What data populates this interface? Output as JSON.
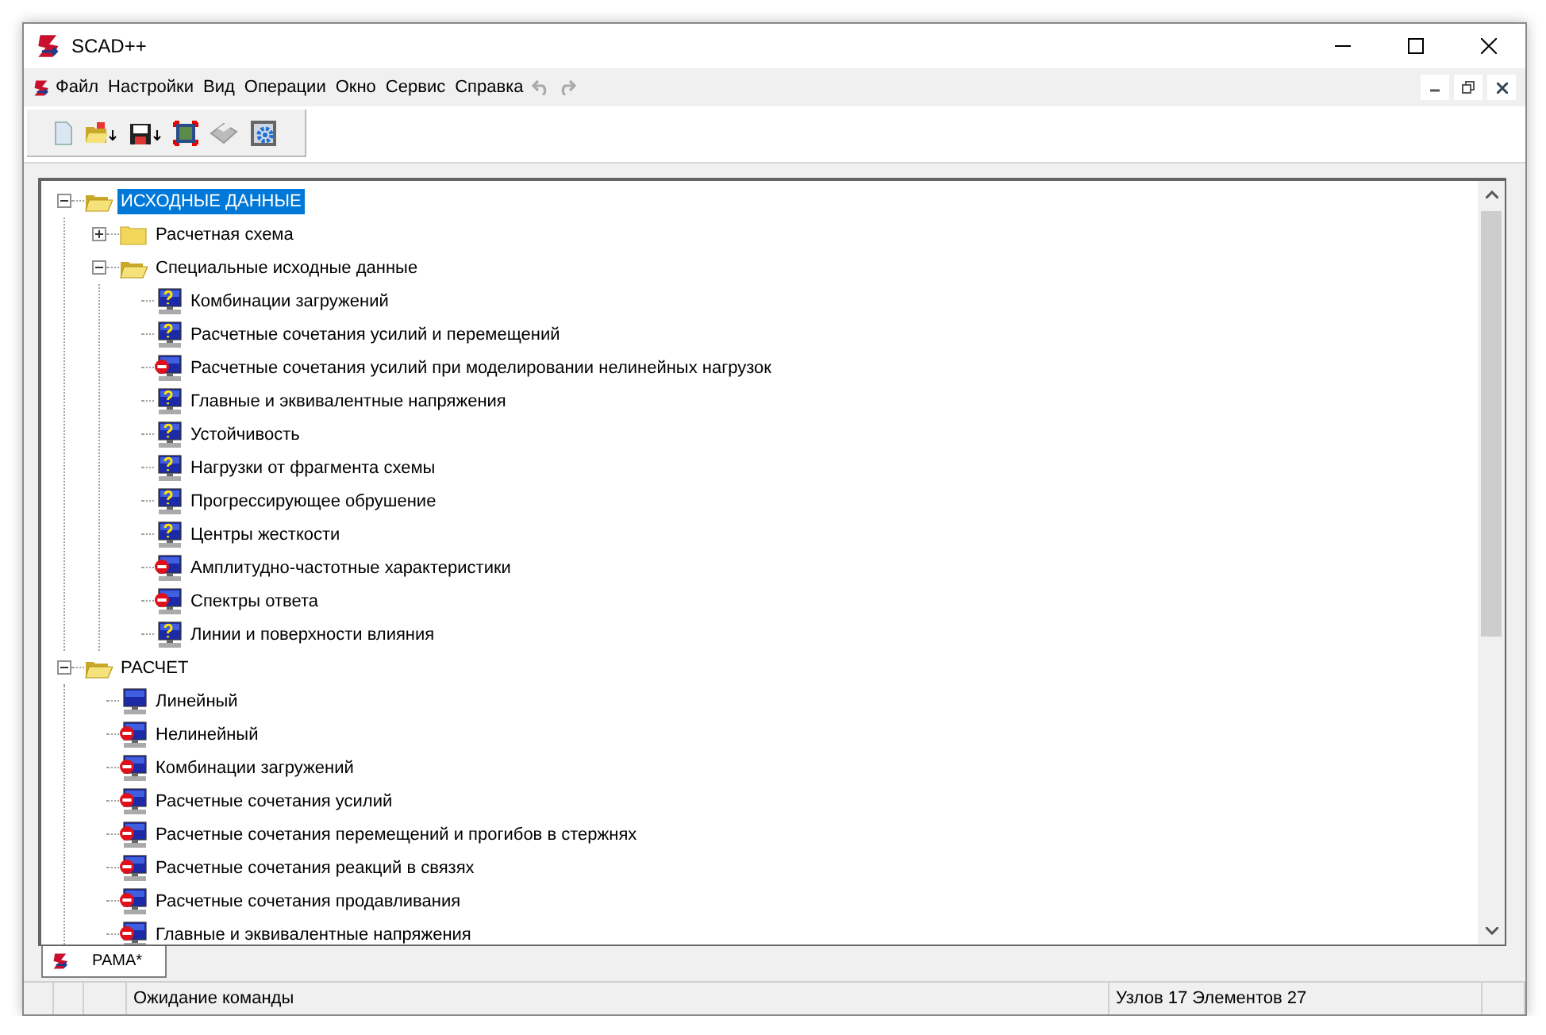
{
  "window": {
    "title": "SCAD++"
  },
  "menu": [
    "Файл",
    "Настройки",
    "Вид",
    "Операции",
    "Окно",
    "Сервис",
    "Справка"
  ],
  "tree": [
    {
      "label": "ИСХОДНЫЕ ДАННЫЕ",
      "kind": "folder",
      "expanded": true,
      "selected": true,
      "children": [
        {
          "label": "Расчетная схема",
          "kind": "folder",
          "expanded": false,
          "selected": false
        },
        {
          "label": "Специальные исходные данные",
          "kind": "folder",
          "expanded": true,
          "selected": false,
          "children": [
            {
              "label": "Комбинации загружений",
              "kind": "question",
              "selected": false
            },
            {
              "label": "Расчетные сочетания усилий и перемещений",
              "kind": "question",
              "selected": false
            },
            {
              "label": "Расчетные сочетания усилий при моделировании нелинейных нагрузок",
              "kind": "blocked",
              "selected": false
            },
            {
              "label": "Главные и эквивалентные напряжения",
              "kind": "question",
              "selected": false
            },
            {
              "label": "Устойчивость",
              "kind": "question",
              "selected": false
            },
            {
              "label": "Нагрузки от фрагмента схемы",
              "kind": "question",
              "selected": false
            },
            {
              "label": "Прогрессирующее обрушение",
              "kind": "question",
              "selected": false
            },
            {
              "label": "Центры жесткости",
              "kind": "question",
              "selected": false
            },
            {
              "label": "Амплитудно-частотные характеристики",
              "kind": "blocked",
              "selected": false
            },
            {
              "label": "Спектры ответа",
              "kind": "blocked",
              "selected": false
            },
            {
              "label": "Линии и поверхности влияния",
              "kind": "question",
              "selected": false
            }
          ]
        }
      ]
    },
    {
      "label": "РАСЧЕТ",
      "kind": "folder",
      "expanded": true,
      "selected": false,
      "children": [
        {
          "label": "Линейный",
          "kind": "ready",
          "selected": false
        },
        {
          "label": "Нелинейный",
          "kind": "blocked",
          "selected": false
        },
        {
          "label": "Комбинации загружений",
          "kind": "blocked",
          "selected": false
        },
        {
          "label": "Расчетные сочетания усилий",
          "kind": "blocked",
          "selected": false
        },
        {
          "label": "Расчетные сочетания перемещений и прогибов в стержнях",
          "kind": "blocked",
          "selected": false
        },
        {
          "label": "Расчетные сочетания реакций в связях",
          "kind": "blocked",
          "selected": false
        },
        {
          "label": "Расчетные сочетания продавливания",
          "kind": "blocked",
          "selected": false
        },
        {
          "label": "Главные и эквивалентные напряжения",
          "kind": "blocked",
          "selected": false
        }
      ]
    }
  ],
  "document_tabs": [
    {
      "label": "РАМА*",
      "selected": true
    }
  ],
  "status_bar": {
    "message": "Ожидание команды",
    "counts": "Узлов 17 Элементов 27"
  }
}
